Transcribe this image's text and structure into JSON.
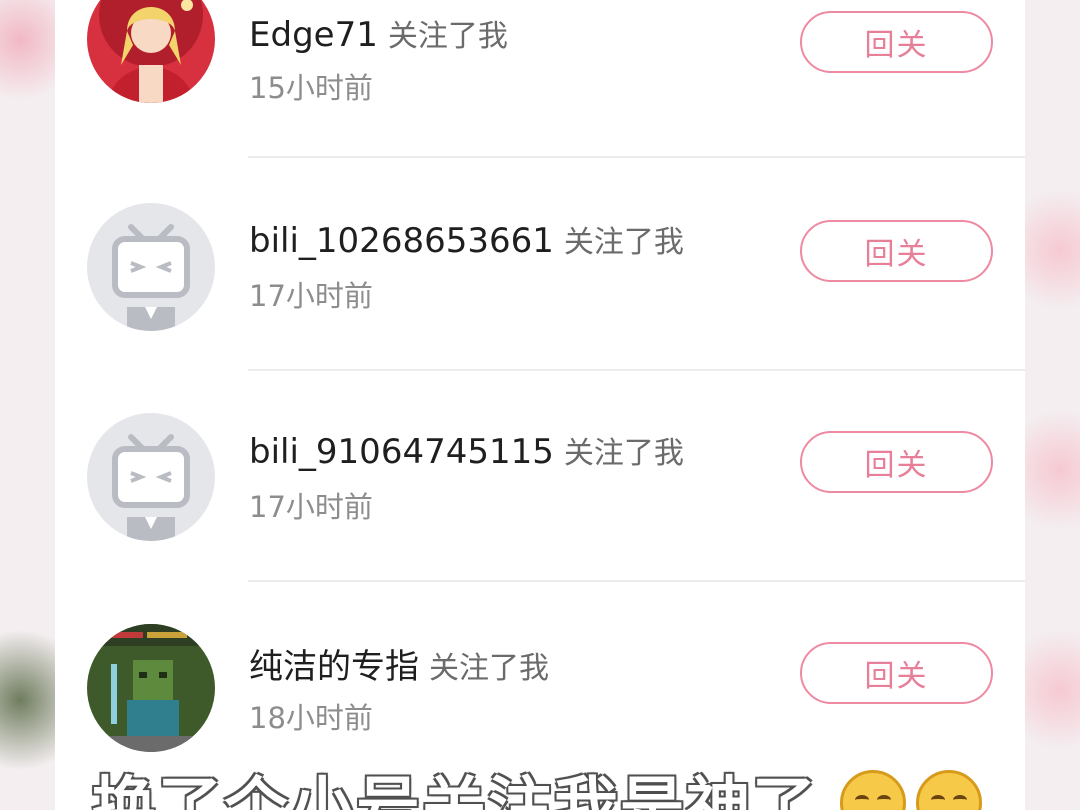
{
  "followers": [
    {
      "username": "Edge71",
      "action": "关注了我",
      "time": "15小时前",
      "button": "回关",
      "avatar": "anime-girl-avatar"
    },
    {
      "username": "bili_10268653661",
      "action": "关注了我",
      "time": "17小时前",
      "button": "回关",
      "avatar": "default-bilibili-tv-avatar"
    },
    {
      "username": "bili_91064745115",
      "action": "关注了我",
      "time": "17小时前",
      "button": "回关",
      "avatar": "default-bilibili-tv-avatar"
    },
    {
      "username": "纯洁的专指",
      "action": "关注了我",
      "time": "18小时前",
      "button": "回关",
      "avatar": "minecraft-zombie-avatar"
    }
  ],
  "caption": "换了个小号关注我是神了",
  "colors": {
    "accent": "#ee8aa2",
    "button_text": "#e87f99",
    "divider": "#ececec"
  }
}
